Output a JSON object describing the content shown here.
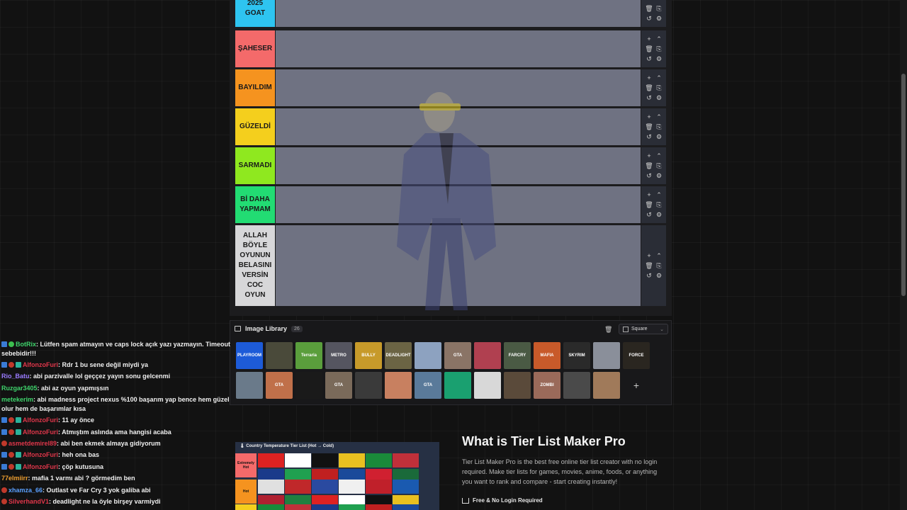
{
  "tiers": [
    {
      "label": "2025\nGOAT",
      "color": "#2ec4f0"
    },
    {
      "label": "ŞAHESER",
      "color": "#f46a6a"
    },
    {
      "label": "BAYILDIM",
      "color": "#f5931f"
    },
    {
      "label": "GÜZELDİ",
      "color": "#f4cf1d"
    },
    {
      "label": "SARMADI",
      "color": "#8fe81f"
    },
    {
      "label": "Bİ DAHA\nYAPMAM",
      "color": "#22dc73"
    },
    {
      "label": "ALLAH\nBÖYLE\nOYUNUN\nBELASINI\nVERSİN\nCOC\nOYUN",
      "color": "#d7d7d9"
    }
  ],
  "tier_controls": [
    "+",
    "⌃",
    "🗑",
    "⎘",
    "↺",
    "⚙"
  ],
  "library": {
    "title": "Image Library",
    "count": "26",
    "size_select": "Square",
    "thumbnails": [
      {
        "text": "PLAYROOM",
        "color": "#1d5bd8"
      },
      {
        "text": "",
        "color": "#4a4a3a"
      },
      {
        "text": "Terraria",
        "color": "#5a9e3c"
      },
      {
        "text": "METRO",
        "color": "#555560"
      },
      {
        "text": "BULLY",
        "color": "#c79a2a"
      },
      {
        "text": "DEADLIGHT",
        "color": "#6b6444"
      },
      {
        "text": "",
        "color": "#8da2c0"
      },
      {
        "text": "GTA",
        "color": "#8a7466"
      },
      {
        "text": "",
        "color": "#b04050"
      },
      {
        "text": "FARCRY",
        "color": "#4a5a44"
      },
      {
        "text": "MAFIA",
        "color": "#c85a2a"
      },
      {
        "text": "SKYRIM",
        "color": "#2a2a2a"
      },
      {
        "text": "",
        "color": "#8a8f9a"
      },
      {
        "text": "FORCE",
        "color": "#2a2620"
      },
      {
        "text": "",
        "color": "#6a7a8a"
      },
      {
        "text": "GTA",
        "color": "#c0704a"
      },
      {
        "text": "",
        "color": "#1a1a1a"
      },
      {
        "text": "GTA",
        "color": "#7a6a5a"
      },
      {
        "text": "",
        "color": "#3a3a3a"
      },
      {
        "text": "",
        "color": "#c88060"
      },
      {
        "text": "GTA",
        "color": "#5a7a9a"
      },
      {
        "text": "",
        "color": "#1aa070"
      },
      {
        "text": "",
        "color": "#d8d8d8"
      },
      {
        "text": "",
        "color": "#5a4a3a"
      },
      {
        "text": "ZOMBI",
        "color": "#9a6a5a"
      },
      {
        "text": "",
        "color": "#4a4a4a"
      },
      {
        "text": "",
        "color": "#a07a5a"
      },
      {
        "text": "+",
        "color": "transparent"
      }
    ]
  },
  "chat": [
    {
      "user": "BotRix",
      "user_color": "#3fd46c",
      "text": ": Lütfen spam atmayın ve caps lock açık yazı yazmayın. Timeout sebebidir!!!",
      "badges": [
        "b-blue",
        "b-green"
      ],
      "wrap": true
    },
    {
      "user": "AlfonzoFuri",
      "user_color": "#e0364a",
      "text": ": Rdr 1 bu sene değil miydi ya",
      "badges": [
        "b-blue",
        "b-red",
        "b-teal"
      ]
    },
    {
      "user": "Rio_Batu",
      "user_color": "#9a7bff",
      "text": ": abi parzivalle lol geççez yayın sonu gelcenmi",
      "badges": []
    },
    {
      "user": "Ruzgar3405",
      "user_color": "#3fd46c",
      "text": ": abi az oyun yapmışsın",
      "badges": []
    },
    {
      "user": "metekerim",
      "user_color": "#3fd46c",
      "text": ": abi madness project nexus %100 başarım yap bence hem güzel olur hem de başarımlar kısa",
      "badges": [],
      "wrap": true
    },
    {
      "user": "AlfonzoFuri",
      "user_color": "#e0364a",
      "text": ": 11 ay önce",
      "badges": [
        "b-blue",
        "b-red",
        "b-teal"
      ]
    },
    {
      "user": "AlfonzoFuri",
      "user_color": "#e0364a",
      "text": ": Atmıştım aslında ama hangisi acaba",
      "badges": [
        "b-blue",
        "b-red",
        "b-teal"
      ]
    },
    {
      "user": "asmetdemirel89",
      "user_color": "#e0364a",
      "text": ": abi ben ekmek almaya gidiyorum",
      "badges": [
        "b-red"
      ]
    },
    {
      "user": "AlfonzoFuri",
      "user_color": "#e0364a",
      "text": ": heh ona bas",
      "badges": [
        "b-blue",
        "b-red",
        "b-teal"
      ]
    },
    {
      "user": "AlfonzoFuri",
      "user_color": "#e0364a",
      "text": ": çöp kutusuna",
      "badges": [
        "b-blue",
        "b-red",
        "b-teal"
      ]
    },
    {
      "user": "77elmiirr",
      "user_color": "#f0a030",
      "text": ": mafia 1 varmı abi ? görmedim ben",
      "badges": []
    },
    {
      "user": "xhamza_66",
      "user_color": "#5aa0ff",
      "text": ": Outlast ve Far Cry 3 yok galiba abi",
      "badges": [
        "b-red"
      ]
    },
    {
      "user": "SilverhandV1",
      "user_color": "#e0364a",
      "text": ": deadlight ne la öyle birşey varmiydi",
      "badges": [
        "b-red"
      ]
    }
  ],
  "preview": {
    "title": "🌡 Country Temperature Tier List (Hot → Cold)",
    "rows": [
      {
        "label": "Extremely Hot",
        "color": "#f46a6a"
      },
      {
        "label": "Hot",
        "color": "#f5931f"
      },
      {
        "label": "",
        "color": "#f4cf1d"
      }
    ],
    "flag_colors": [
      "#d22",
      "#fff",
      "#111",
      "#e8c020",
      "#1a8a3a",
      "#c0303a",
      "#1a3a8a",
      "#20a050",
      "#c02020",
      "#1a4a9a",
      "#d02030",
      "#1a6a3a",
      "#e0e0e0",
      "#c0282a",
      "#2a4aa0",
      "#f0f0f0",
      "#c0202a",
      "#1a5ab0",
      "#b02030",
      "#208040"
    ]
  },
  "info": {
    "title": "What is Tier List Maker Pro",
    "description": "Tier List Maker Pro is the best free online tier list creator with no login required. Make tier lists for games, movies, anime, foods, or anything you want to rank and compare - start creating instantly!",
    "feature": "Free & No Login Required"
  }
}
